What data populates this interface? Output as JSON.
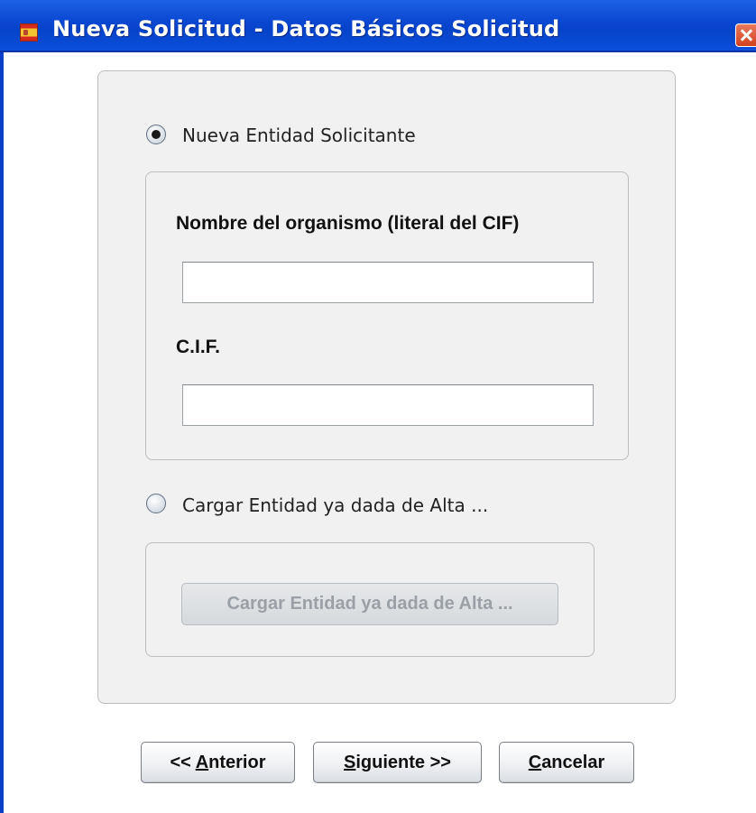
{
  "window": {
    "title": "Nueva Solicitud - Datos Básicos Solicitud",
    "icon": "spain-coat-of-arms-icon",
    "close_icon": "close-icon"
  },
  "new_entity": {
    "radio_label": "Nueva Entidad Solicitante",
    "selected": true,
    "name_label": "Nombre del organismo (literal del CIF)",
    "name_value": "",
    "cif_label": "C.I.F.",
    "cif_value": ""
  },
  "load_entity": {
    "radio_label": "Cargar Entidad ya dada de Alta ...",
    "selected": false,
    "button_label": "Cargar Entidad ya dada de Alta ...",
    "button_enabled": false
  },
  "buttons": {
    "previous": {
      "prefix": "<< ",
      "mnemonic": "A",
      "rest": "nterior"
    },
    "next": {
      "mnemonic": "S",
      "rest": "iguiente >>"
    },
    "cancel": {
      "mnemonic": "C",
      "rest": "ancelar"
    }
  },
  "colors": {
    "titlebar": "#0a46d0",
    "panel_bg": "#f1f1f1",
    "close_button": "#d2401c"
  }
}
